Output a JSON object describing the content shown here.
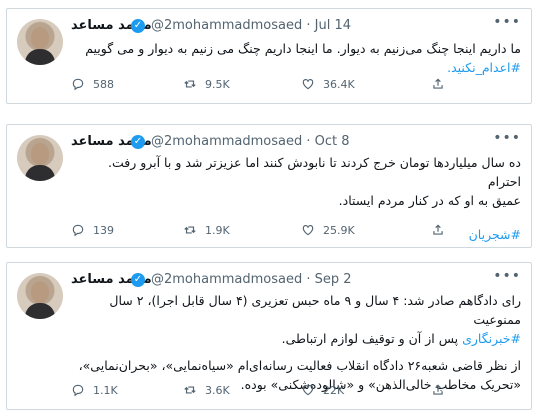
{
  "tweets": [
    {
      "name": "محمد مساعد",
      "handle_line": "@2mohammadmosaed · Jul 14",
      "text_lines": [
        "ما داریم اینجا چنگ می‌زنیم به دیوار. ما اینجا داریم چنگ می زنیم به دیوار و می گوییم"
      ],
      "hashtags": [
        "#اعدام_نکنید."
      ],
      "replies": "588",
      "retweets": "9.5K",
      "likes": "36.4K"
    },
    {
      "name": "محمد مساعد",
      "handle_line": "@2mohammadmosaed · Oct 8",
      "text_lines": [
        "ده سال میلیاردها تومان خرج کردند تا نابودش کنند اما عزیزتر شد و با آبرو رفت. احترام",
        "عمیق به او که در کنار مردم ایستاد."
      ],
      "hashtags": [
        "#شجریان"
      ],
      "replies": "139",
      "retweets": "1.9K",
      "likes": "25.9K"
    },
    {
      "name": "محمد مساعد",
      "handle_line": "@2mohammadmosaed · Sep 2",
      "text_lines": [
        "رای دادگاهم صادر شد: ۴ سال و ۹ ماه حبس تعزیری (۴ سال قابل اجرا)، ۲ سال ممنوعیت",
        "پس از آن و توقیف لوازم ارتباطی.",
        "از نظر قاضی شعبه۲۶ دادگاه انقلاب فعالیت رسانه‌ای‌ام «سیاه‌نمایی»، «بحران‌نمایی»،",
        "«تحریک مخاطب خالی‌الذهن» و «شالوده‌شکنی» بوده."
      ],
      "hashtags": [
        "#خبرنگاری"
      ],
      "replies": "1.1K",
      "retweets": "3.6K",
      "likes": "22K"
    }
  ],
  "icons": {
    "more": "more-dots-icon",
    "reply": "reply-icon",
    "retweet": "retweet-icon",
    "like": "like-icon",
    "share": "share-icon",
    "verified": "verified-badge-icon"
  },
  "colors": {
    "accent": "#1d9bf0",
    "muted": "#536471",
    "border": "#cfd9de"
  }
}
